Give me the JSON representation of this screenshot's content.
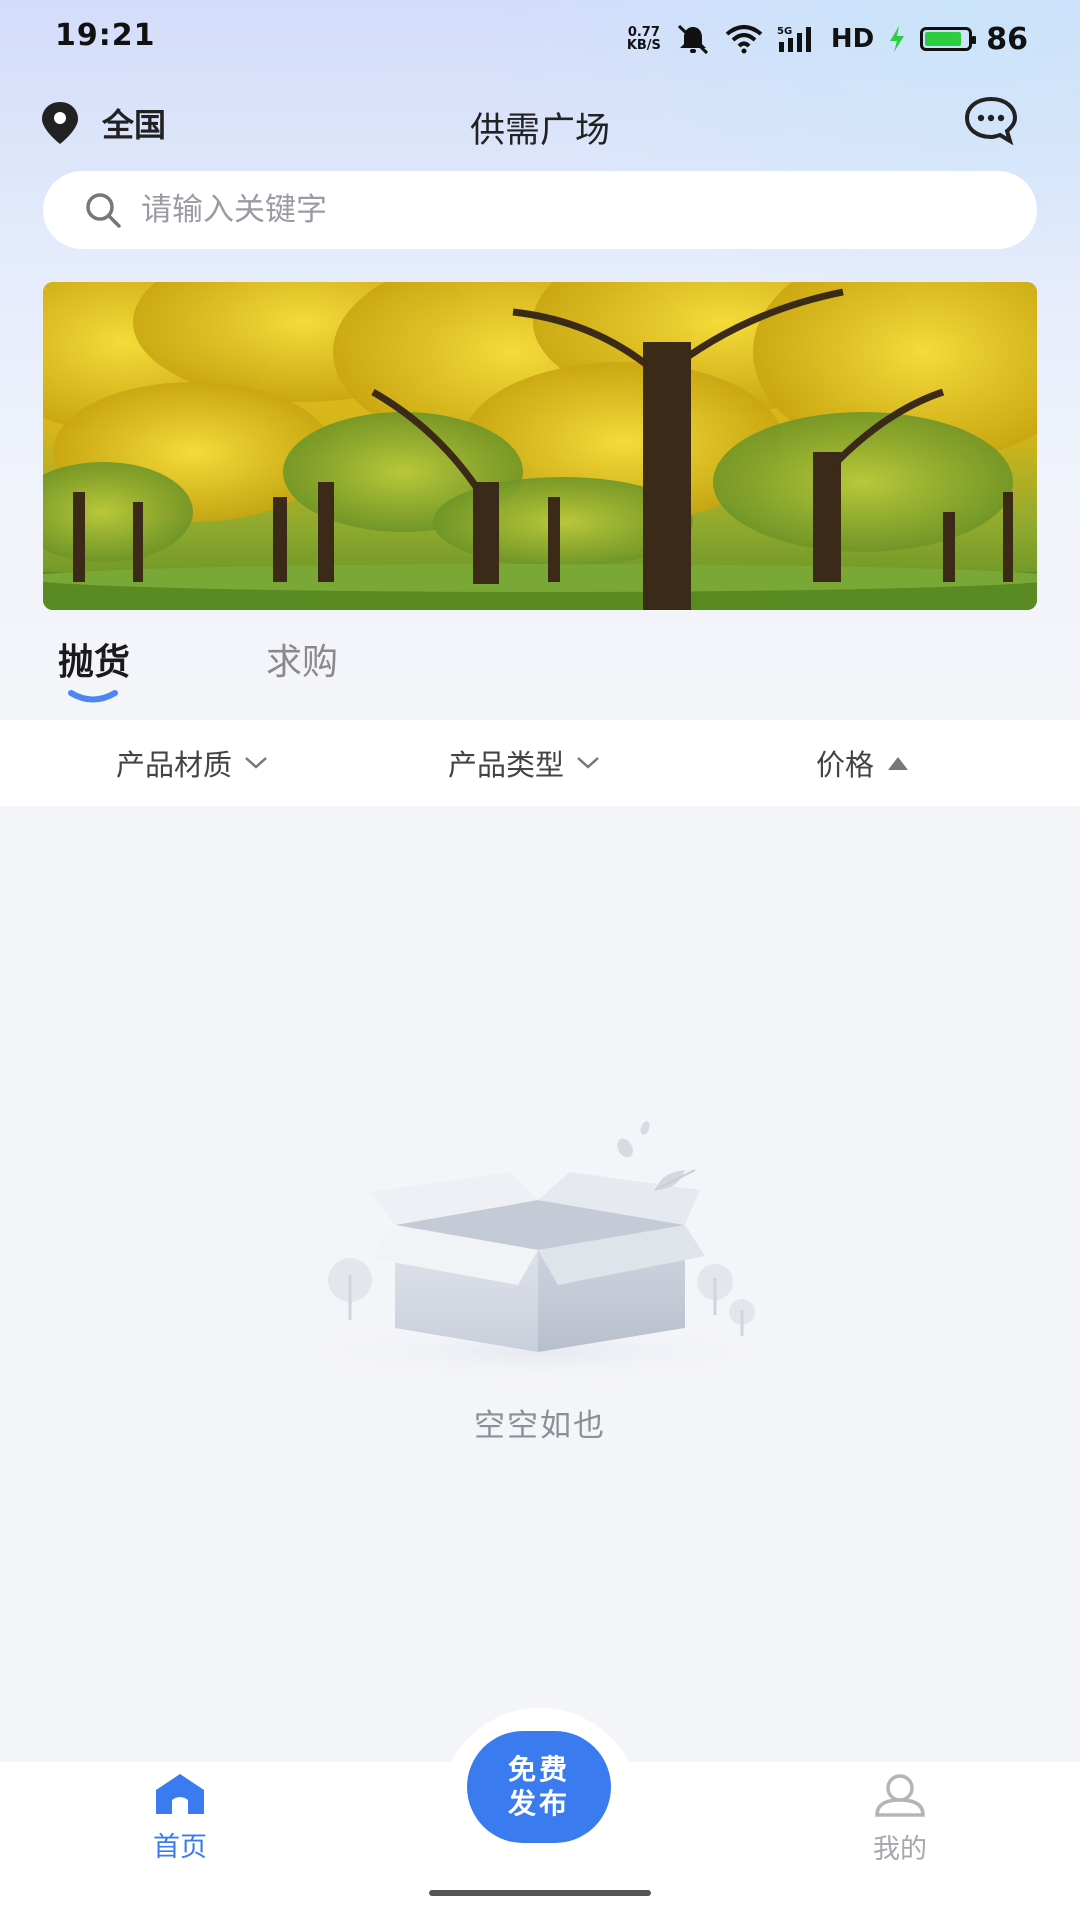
{
  "status_bar": {
    "time": "19:21",
    "net_speed_value": "0.77",
    "net_speed_unit": "KB/S",
    "network_type": "5G",
    "hd": "HD",
    "battery": "86"
  },
  "header": {
    "location": "全国",
    "title": "供需广场",
    "icons": {
      "location": "location-pin-icon",
      "messages": "chat-bubble-icon"
    }
  },
  "search": {
    "placeholder": "请输入关键字",
    "icon": "search-icon"
  },
  "banner": {
    "description_icon": "autumn-trees-image"
  },
  "tabs": [
    {
      "label": "抛货",
      "active": true
    },
    {
      "label": "求购",
      "active": false
    }
  ],
  "filters": [
    {
      "label": "产品材质",
      "icon": "chevron-down-icon"
    },
    {
      "label": "产品类型",
      "icon": "chevron-down-icon"
    },
    {
      "label": "价格",
      "icon": "triangle-up-icon"
    }
  ],
  "empty_state": {
    "text": "空空如也",
    "icon": "empty-box-icon"
  },
  "bottom_nav": {
    "home": {
      "label": "首页",
      "icon": "home-icon",
      "active": true
    },
    "publish": {
      "line1": "免费",
      "line2": "发布"
    },
    "me": {
      "label": "我的",
      "icon": "user-icon",
      "active": false
    }
  },
  "colors": {
    "accent": "#3a7bf0",
    "background": "#f4f5f9",
    "battery": "#2ecc40"
  }
}
